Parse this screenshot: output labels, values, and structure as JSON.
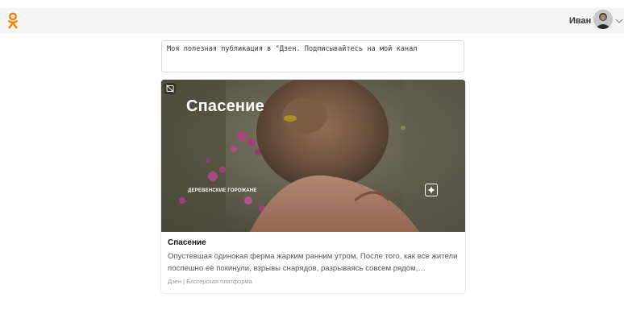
{
  "header": {
    "user_name": "Иван"
  },
  "post": {
    "text": "Моя полезная публикация в \"Дзен. Подписывайтесь на мой канал"
  },
  "card": {
    "image_title": "Спасение",
    "image_channel": "ДЕРЕВЕНСКИЕ ГОРОЖАНЕ",
    "title": "Спасение",
    "description": "Опустевшая одинокая ферма жарким ранним утром. После того, как все жители поспешно её покинули, взрывы снарядов, разрываясь совсем рядом,…",
    "source": "Дзен | Блогерская платформа"
  },
  "colors": {
    "brand": "#ee8208",
    "topbar_bg": "#f5f5f5"
  }
}
